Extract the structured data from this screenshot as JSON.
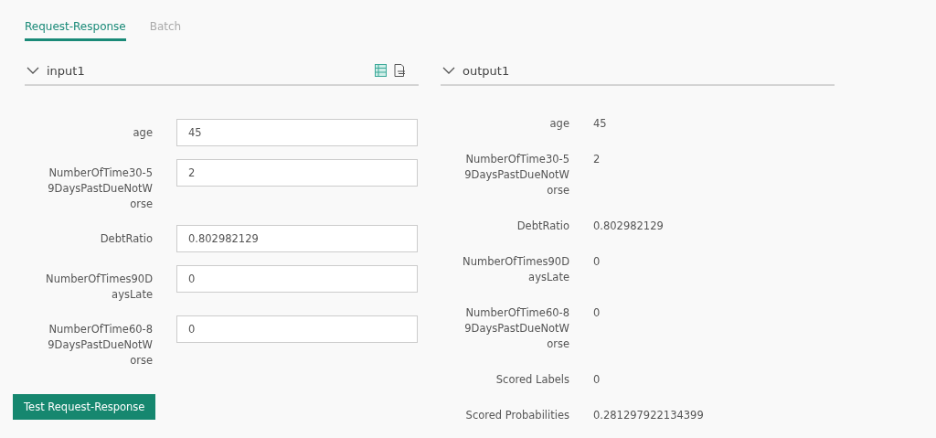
{
  "tabs": [
    {
      "label": "Request-Response",
      "selected": true
    },
    {
      "label": "Batch",
      "selected": false
    }
  ],
  "input": {
    "title": "input1",
    "expanded": true,
    "fields": [
      {
        "label": "age",
        "value": "45"
      },
      {
        "label": "NumberOfTime30-59DaysPastDueNotWorse",
        "value": "2"
      },
      {
        "label": "DebtRatio",
        "value": "0.802982129"
      },
      {
        "label": "NumberOfTimes90DaysLate",
        "value": "0"
      },
      {
        "label": "NumberOfTime60-89DaysPastDueNotWorse",
        "value": "0"
      }
    ]
  },
  "test_button": "Test Request-Response",
  "output": {
    "title": "output1",
    "expanded": true,
    "fields": [
      {
        "label": "age",
        "value": "45"
      },
      {
        "label": "NumberOfTime30-59DaysPastDueNotWorse",
        "value": "2"
      },
      {
        "label": "DebtRatio",
        "value": "0.802982129"
      },
      {
        "label": "NumberOfTimes90DaysLate",
        "value": "0"
      },
      {
        "label": "NumberOfTime60-89DaysPastDueNotWorse",
        "value": "0"
      },
      {
        "label": "Scored Labels",
        "value": "0"
      },
      {
        "label": "Scored Probabilities",
        "value": "0.281297922134399"
      }
    ]
  }
}
